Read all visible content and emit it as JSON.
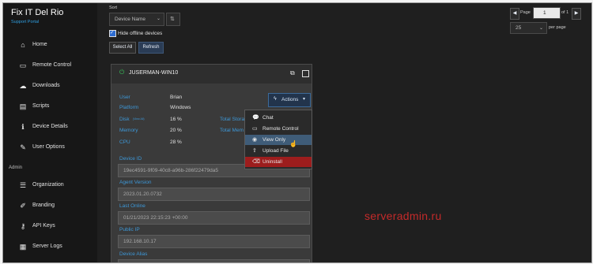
{
  "brand": {
    "title": "Fix IT Del Rio",
    "subtitle": "Support Portal"
  },
  "sidebar": {
    "items": [
      {
        "label": "Home",
        "icon": "home-icon"
      },
      {
        "label": "Remote Control",
        "icon": "monitor-icon"
      },
      {
        "label": "Downloads",
        "icon": "cloud-download-icon"
      },
      {
        "label": "Scripts",
        "icon": "scroll-icon"
      },
      {
        "label": "Device Details",
        "icon": "info-icon"
      },
      {
        "label": "User Options",
        "icon": "pencil-icon"
      }
    ],
    "admin_header": "Admin",
    "admin_items": [
      {
        "label": "Organization",
        "icon": "organization-icon"
      },
      {
        "label": "Branding",
        "icon": "brush-icon"
      },
      {
        "label": "API Keys",
        "icon": "key-icon"
      },
      {
        "label": "Server Logs",
        "icon": "file-icon"
      }
    ]
  },
  "toolbar": {
    "sort_label": "Sort",
    "sort_value": "Device Name",
    "hide_offline_label": "Hide offline devices",
    "select_all": "Select All",
    "refresh": "Refresh"
  },
  "pager": {
    "page_label": "Page",
    "page_value": "1",
    "of_label": "of 1",
    "per_page_value": "25",
    "per_page_label": "per page"
  },
  "device": {
    "name": "JUSERMAN-WIN10",
    "actions_label": "Actions",
    "fields": {
      "user_label": "User",
      "user_value": "Brian",
      "platform_label": "Platform",
      "platform_value": "Windows",
      "disk_label": "Disk",
      "disk_small": "(View All)",
      "disk_value": "16 %",
      "memory_label": "Memory",
      "memory_value": "20 %",
      "cpu_label": "CPU",
      "cpu_value": "28 %",
      "total_storage_label": "Total Stora",
      "total_memory_label": "Total Mem"
    },
    "device_id_label": "Device ID",
    "device_id_value": "19ec4591-9f09-40c8-a96b-286f22479da5",
    "agent_version_label": "Agent Version",
    "agent_version_value": "2023.01.20.0732",
    "last_online_label": "Last Online",
    "last_online_value": "01/21/2023 22:15:23 +00:00",
    "public_ip_label": "Public IP",
    "public_ip_value": "192.168.10.17",
    "device_alias_label": "Device Alias"
  },
  "actions_menu": [
    {
      "label": "Chat",
      "icon": "chat-icon"
    },
    {
      "label": "Remote Control",
      "icon": "monitor-icon"
    },
    {
      "label": "View Only",
      "icon": "eye-icon"
    },
    {
      "label": "Upload File",
      "icon": "upload-icon"
    },
    {
      "label": "Uninstall",
      "icon": "trash-icon"
    }
  ],
  "watermark": "serveradmin.ru"
}
